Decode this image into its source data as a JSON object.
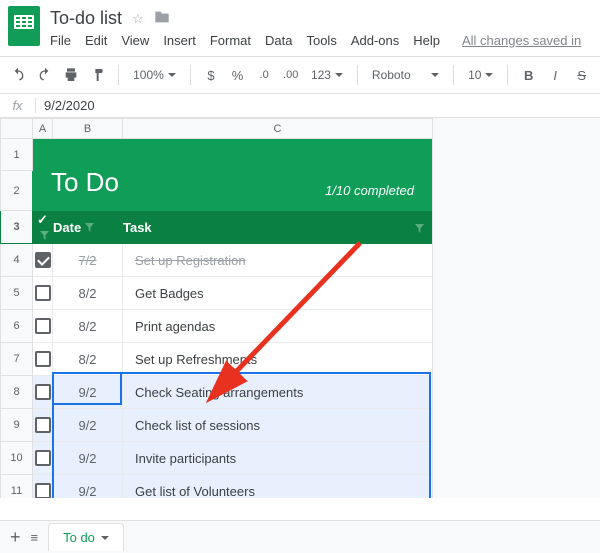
{
  "doc": {
    "title": "To-do list",
    "saved": "All changes saved in"
  },
  "menu": [
    "File",
    "Edit",
    "View",
    "Insert",
    "Format",
    "Data",
    "Tools",
    "Add-ons",
    "Help"
  ],
  "toolbar": {
    "zoom": "100%",
    "currency": "$",
    "percent": "%",
    "dec_down": ".0",
    "dec_up": ".00",
    "numfmt": "123",
    "font": "Roboto",
    "size": "10"
  },
  "formula": {
    "label": "fx",
    "value": "9/2/2020"
  },
  "columns": [
    "A",
    "B",
    "C"
  ],
  "todo": {
    "heading": "To Do",
    "progress": "1/10 completed",
    "col_check": "✓",
    "col_date": "Date",
    "col_task": "Task",
    "rows": [
      {
        "n": "4",
        "done": true,
        "date": "7/2",
        "task": "Set up Registration"
      },
      {
        "n": "5",
        "done": false,
        "date": "8/2",
        "task": "Get Badges"
      },
      {
        "n": "6",
        "done": false,
        "date": "8/2",
        "task": "Print agendas"
      },
      {
        "n": "7",
        "done": false,
        "date": "8/2",
        "task": "Set up Refreshments"
      },
      {
        "n": "8",
        "done": false,
        "date": "9/2",
        "task": "Check Seating arrangements"
      },
      {
        "n": "9",
        "done": false,
        "date": "9/2",
        "task": "Check list of sessions"
      },
      {
        "n": "10",
        "done": false,
        "date": "9/2",
        "task": "Invite participants"
      },
      {
        "n": "11",
        "done": false,
        "date": "9/2",
        "task": "Get list of Volunteers"
      }
    ]
  },
  "tabs": {
    "name": "To do"
  }
}
